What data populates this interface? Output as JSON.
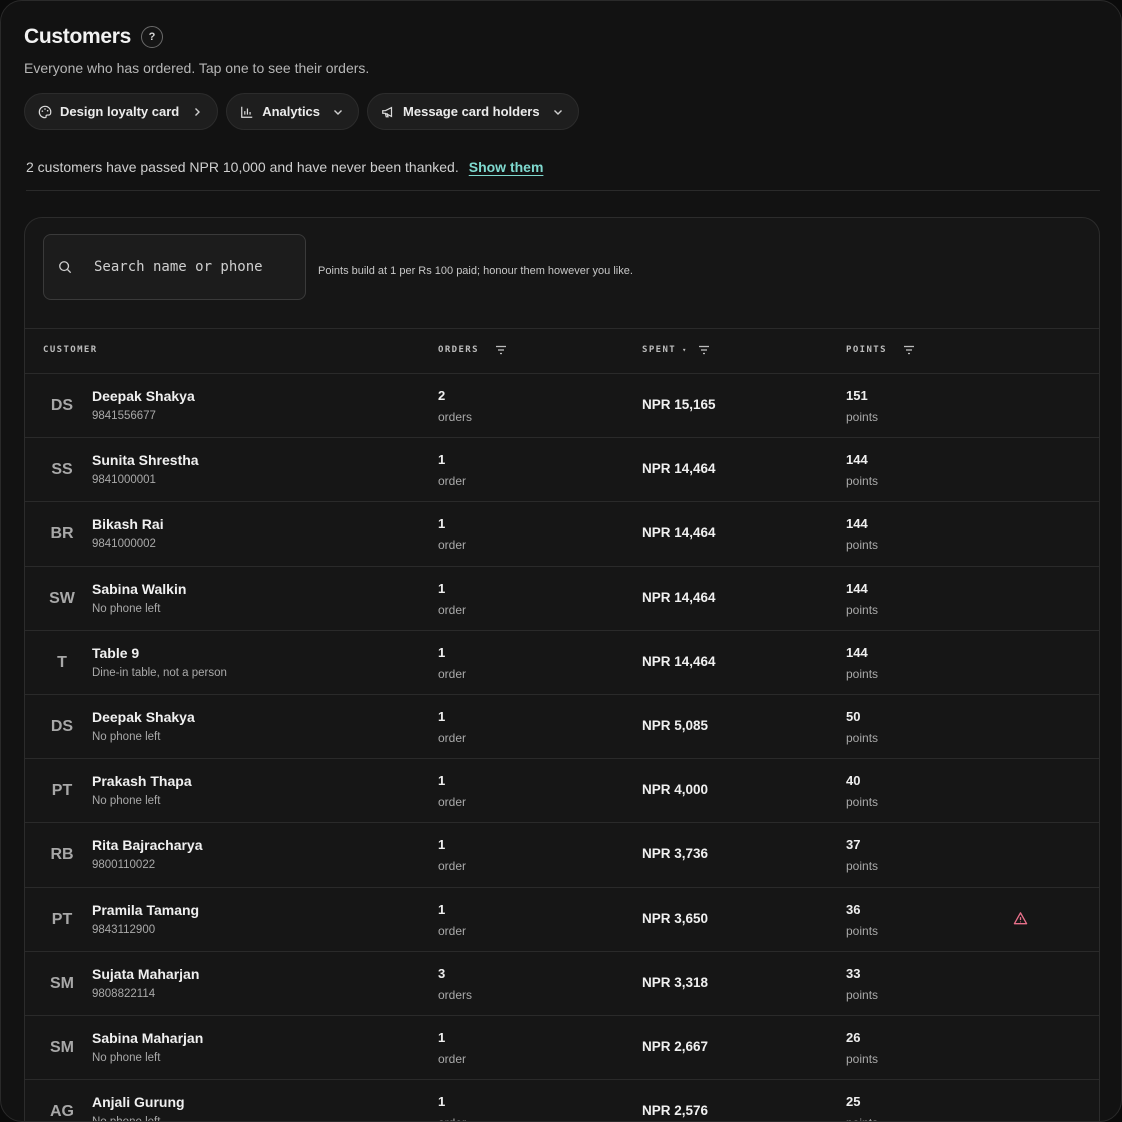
{
  "header": {
    "title": "Customers",
    "help_label": "?",
    "subtitle": "Everyone who has ordered. Tap one to see their orders."
  },
  "actions": [
    {
      "label": "Design loyalty card",
      "icon": "palette-icon",
      "trail": "chevron-right-icon"
    },
    {
      "label": "Analytics",
      "icon": "bar-chart-icon",
      "trail": "chevron-down-icon"
    },
    {
      "label": "Message card holders",
      "icon": "megaphone-icon",
      "trail": "chevron-down-icon"
    }
  ],
  "notice": {
    "text": "2 customers have passed NPR 10,000 and have never been thanked.",
    "link": "Show them"
  },
  "search": {
    "placeholder": "Search name or phone",
    "value": ""
  },
  "points_note": "Points build at 1 per Rs 100 paid; honour them however you like.",
  "table": {
    "columns": {
      "customer": "CUSTOMER",
      "orders": "ORDERS",
      "spent": "SPENT",
      "spent_sort": "▾",
      "points": "POINTS"
    },
    "rows": [
      {
        "initials": "DS",
        "name": "Deepak Shakya",
        "sub": "9841556677",
        "orders": "2",
        "orders_label": "orders",
        "spent": "NPR 15,165",
        "points": "151",
        "points_label": "points"
      },
      {
        "initials": "SS",
        "name": "Sunita Shrestha",
        "sub": "9841000001",
        "orders": "1",
        "orders_label": "order",
        "spent": "NPR 14,464",
        "points": "144",
        "points_label": "points"
      },
      {
        "initials": "BR",
        "name": "Bikash Rai",
        "sub": "9841000002",
        "orders": "1",
        "orders_label": "order",
        "spent": "NPR 14,464",
        "points": "144",
        "points_label": "points"
      },
      {
        "initials": "SW",
        "name": "Sabina Walkin",
        "sub": "No phone left",
        "orders": "1",
        "orders_label": "order",
        "spent": "NPR 14,464",
        "points": "144",
        "points_label": "points"
      },
      {
        "initials": "T",
        "name": "Table 9",
        "sub": "Dine-in table, not a person",
        "orders": "1",
        "orders_label": "order",
        "spent": "NPR 14,464",
        "points": "144",
        "points_label": "points"
      },
      {
        "initials": "DS",
        "name": "Deepak Shakya",
        "sub": "No phone left",
        "orders": "1",
        "orders_label": "order",
        "spent": "NPR 5,085",
        "points": "50",
        "points_label": "points"
      },
      {
        "initials": "PT",
        "name": "Prakash Thapa",
        "sub": "No phone left",
        "orders": "1",
        "orders_label": "order",
        "spent": "NPR 4,000",
        "points": "40",
        "points_label": "points"
      },
      {
        "initials": "RB",
        "name": "Rita Bajracharya",
        "sub": "9800110022",
        "orders": "1",
        "orders_label": "order",
        "spent": "NPR 3,736",
        "points": "37",
        "points_label": "points"
      },
      {
        "initials": "PT",
        "name": "Pramila Tamang",
        "sub": "9843112900",
        "orders": "1",
        "orders_label": "order",
        "spent": "NPR 3,650",
        "points": "36",
        "points_label": "points",
        "warning": true
      },
      {
        "initials": "SM",
        "name": "Sujata Maharjan",
        "sub": "9808822114",
        "orders": "3",
        "orders_label": "orders",
        "spent": "NPR 3,318",
        "points": "33",
        "points_label": "points"
      },
      {
        "initials": "SM",
        "name": "Sabina Maharjan",
        "sub": "No phone left",
        "orders": "1",
        "orders_label": "order",
        "spent": "NPR 2,667",
        "points": "26",
        "points_label": "points"
      },
      {
        "initials": "AG",
        "name": "Anjali Gurung",
        "sub": "No phone left",
        "orders": "1",
        "orders_label": "order",
        "spent": "NPR 2,576",
        "points": "25",
        "points_label": "points"
      }
    ]
  },
  "colors": {
    "background": "#121212",
    "panel": "#161616",
    "link_accent": "#7fd9cf",
    "warning": "#e8708a"
  }
}
